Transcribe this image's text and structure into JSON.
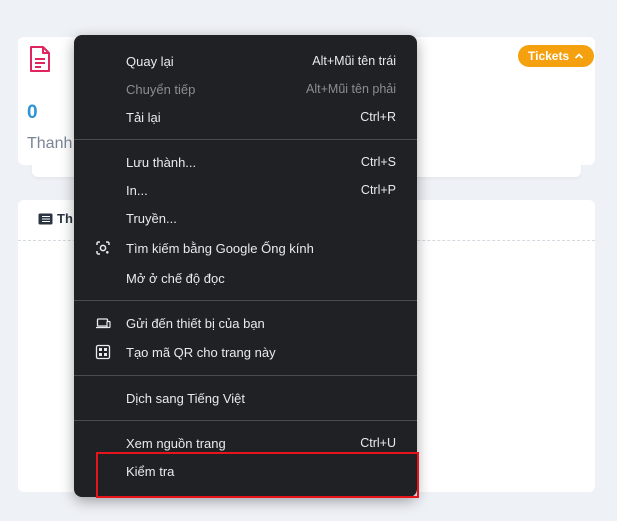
{
  "page": {
    "tickets_badge": "Tickets",
    "stat_value": "0",
    "stat_label": "Thanh",
    "section_title": "Th"
  },
  "menu": {
    "items": [
      {
        "label": "Quay lại",
        "shortcut": "Alt+Mũi tên trái",
        "disabled": false
      },
      {
        "label": "Chuyển tiếp",
        "shortcut": "Alt+Mũi tên phải",
        "disabled": true
      },
      {
        "label": "Tải lại",
        "shortcut": "Ctrl+R",
        "disabled": false
      },
      {
        "label": "Lưu thành...",
        "shortcut": "Ctrl+S",
        "disabled": false
      },
      {
        "label": "In...",
        "shortcut": "Ctrl+P",
        "disabled": false
      },
      {
        "label": "Truyền...",
        "shortcut": "",
        "disabled": false
      },
      {
        "label": "Tìm kiếm bằng Google Ống kính",
        "shortcut": "",
        "icon": "lens-icon"
      },
      {
        "label": "Mở ở chế độ đọc",
        "shortcut": ""
      },
      {
        "label": "Gửi đến thiết bị của bạn",
        "shortcut": "",
        "icon": "devices-icon"
      },
      {
        "label": "Tạo mã QR cho trang này",
        "shortcut": "",
        "icon": "qr-code-icon"
      },
      {
        "label": "Dịch sang Tiếng Việt",
        "shortcut": ""
      },
      {
        "label": "Xem nguồn trang",
        "shortcut": "Ctrl+U"
      },
      {
        "label": "Kiểm tra",
        "shortcut": ""
      }
    ]
  },
  "colors": {
    "menu_bg": "#202124",
    "badge": "#f5a00f",
    "stat_value": "#2f95d3",
    "highlight": "#e8141b",
    "doc_icon": "#e0245e"
  }
}
